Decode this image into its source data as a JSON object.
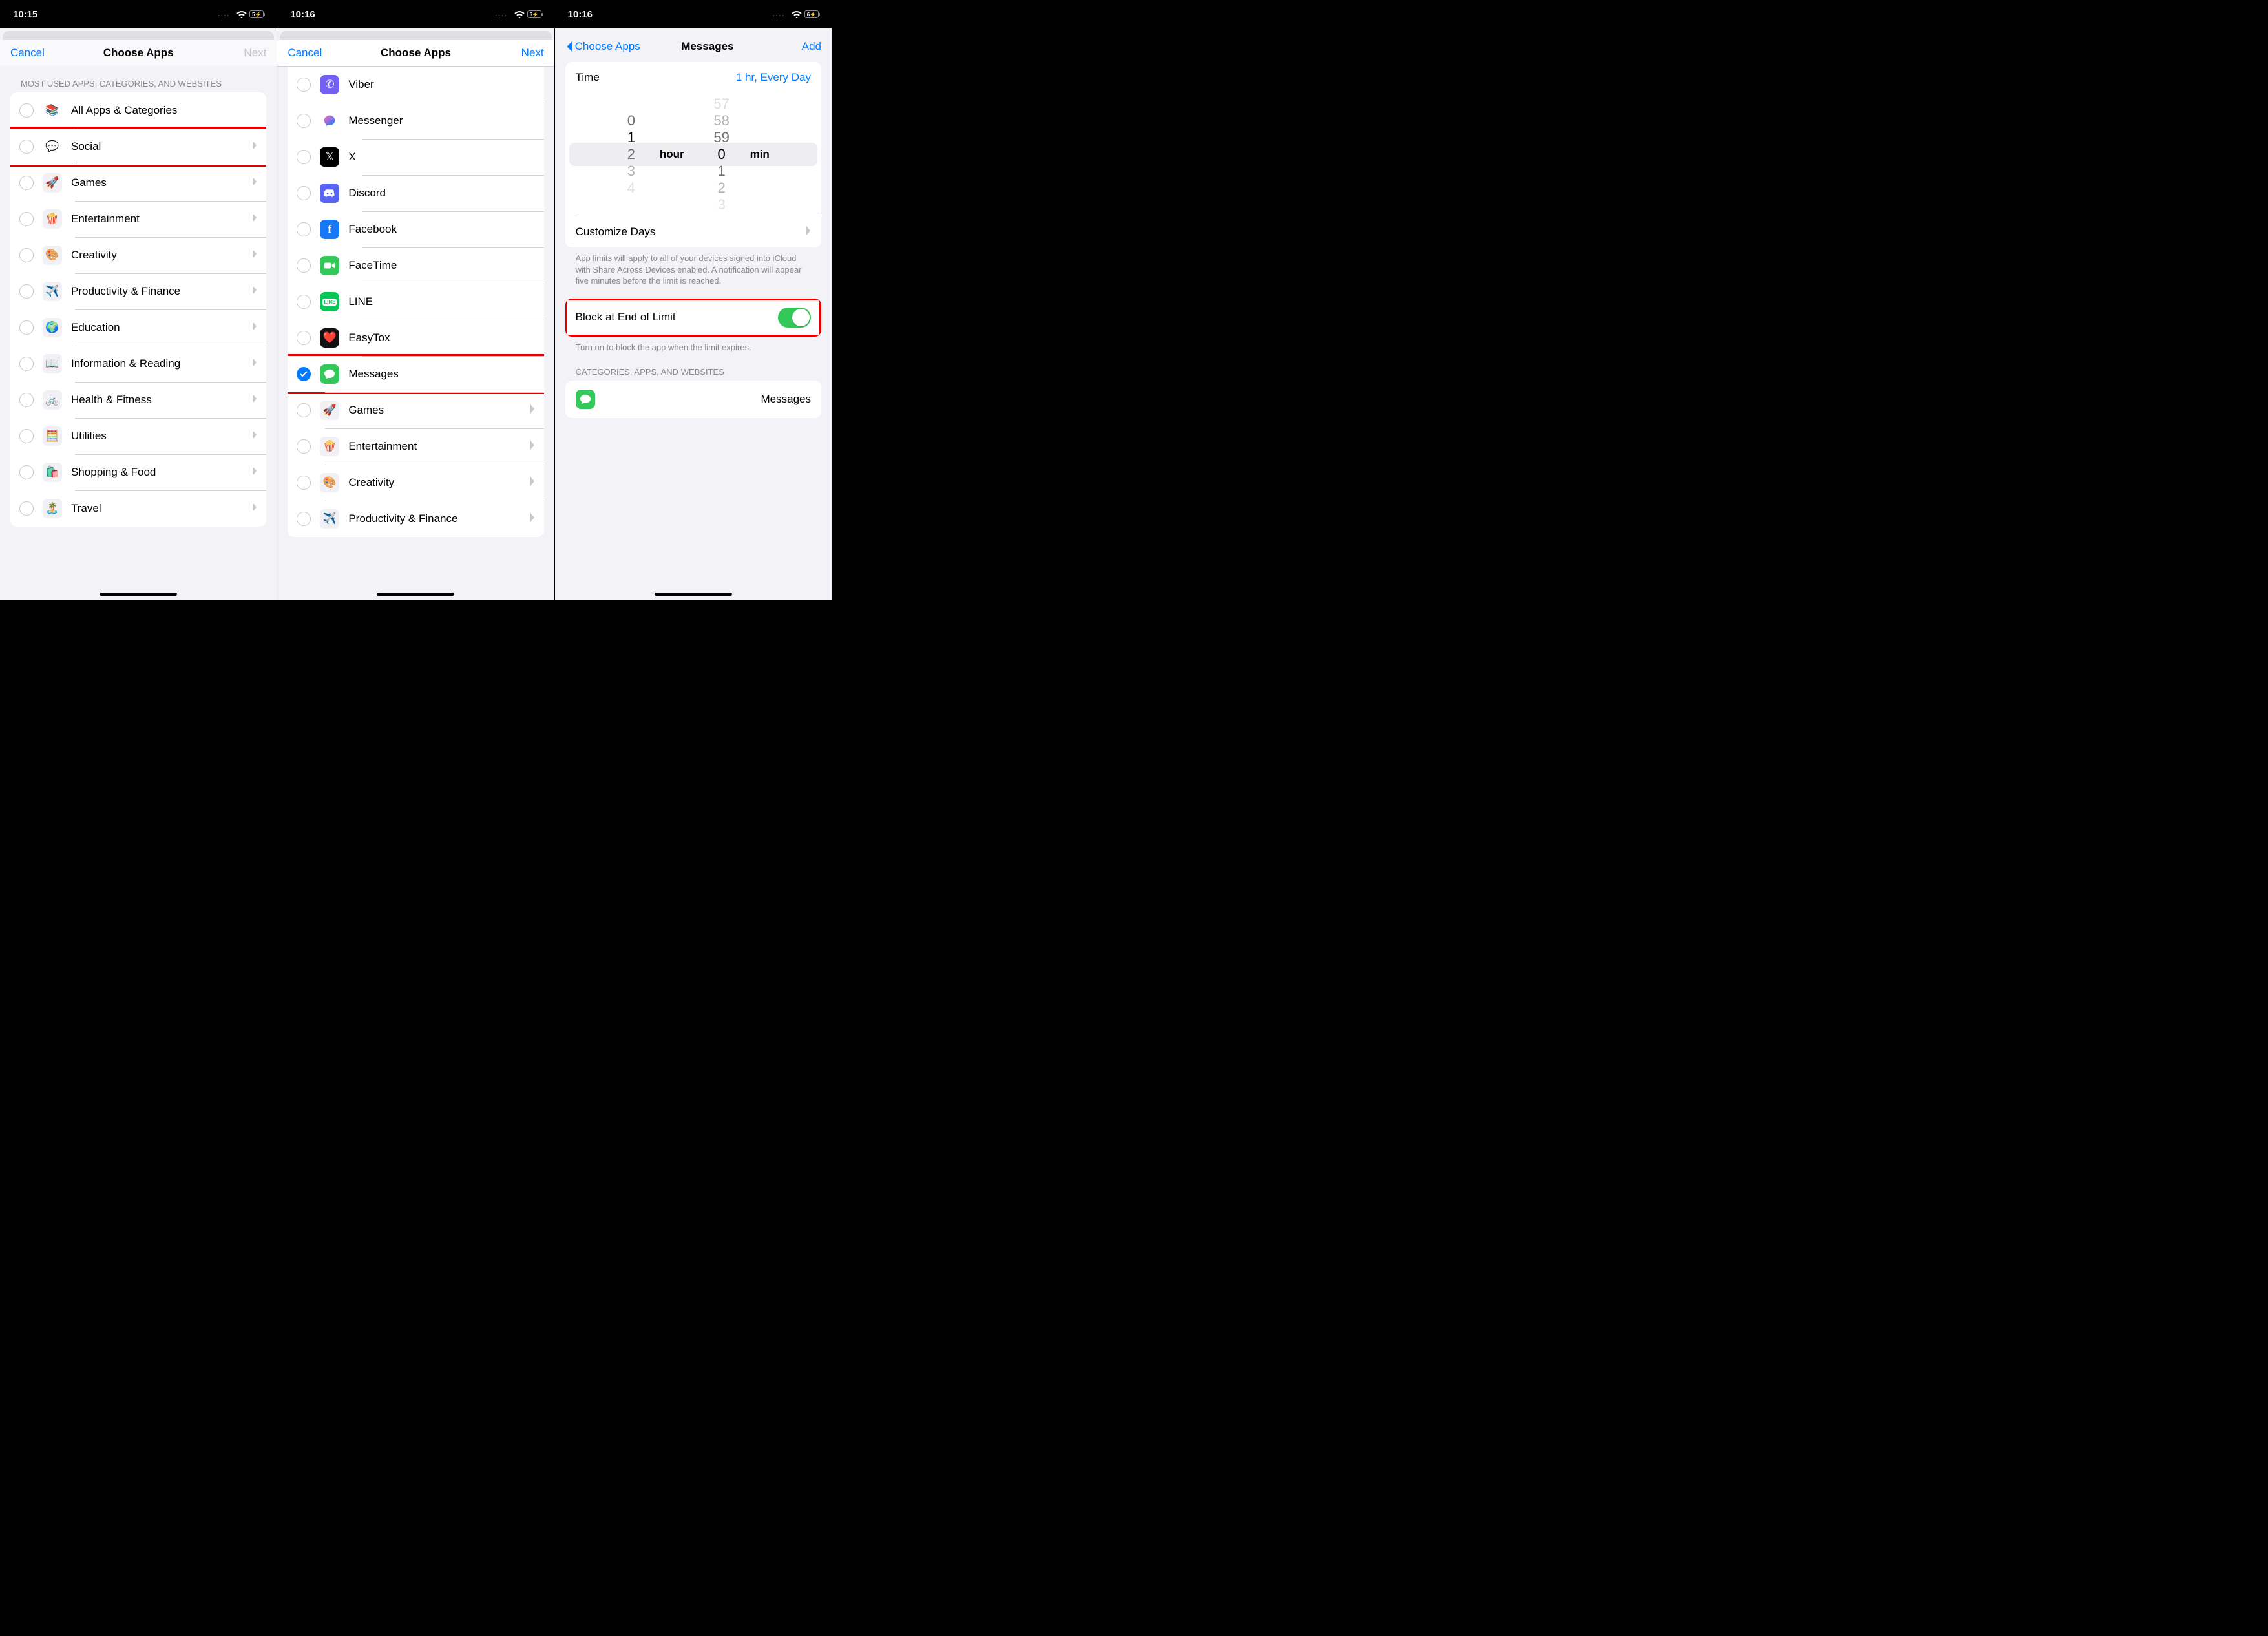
{
  "phone1": {
    "time": "10:15",
    "battery": "5",
    "cancel": "Cancel",
    "title": "Choose Apps",
    "next": "Next",
    "section": "MOST USED APPS, CATEGORIES, AND WEBSITES",
    "rows": [
      {
        "label": "All Apps & Categories"
      },
      {
        "label": "Social"
      },
      {
        "label": "Games"
      },
      {
        "label": "Entertainment"
      },
      {
        "label": "Creativity"
      },
      {
        "label": "Productivity & Finance"
      },
      {
        "label": "Education"
      },
      {
        "label": "Information & Reading"
      },
      {
        "label": "Health & Fitness"
      },
      {
        "label": "Utilities"
      },
      {
        "label": "Shopping & Food"
      },
      {
        "label": "Travel"
      }
    ]
  },
  "phone2": {
    "time": "10:16",
    "battery": "6",
    "cancel": "Cancel",
    "title": "Choose Apps",
    "next": "Next",
    "rows": [
      {
        "label": "Viber"
      },
      {
        "label": "Messenger"
      },
      {
        "label": "X"
      },
      {
        "label": "Discord"
      },
      {
        "label": "Facebook"
      },
      {
        "label": "FaceTime"
      },
      {
        "label": "LINE"
      },
      {
        "label": "EasyTox"
      },
      {
        "label": "Messages"
      },
      {
        "label": "Games"
      },
      {
        "label": "Entertainment"
      },
      {
        "label": "Creativity"
      },
      {
        "label": "Productivity & Finance"
      }
    ]
  },
  "phone3": {
    "time": "10:16",
    "battery": "6",
    "back": "Choose Apps",
    "title": "Messages",
    "add": "Add",
    "time_label": "Time",
    "time_value": "1 hr, Every Day",
    "hour_sel": "1",
    "hour_lbl": "hour",
    "min_sel": "0",
    "min_lbl": "min",
    "picker_hours": [
      "0",
      "1",
      "2",
      "3",
      "4"
    ],
    "picker_mins": [
      "57",
      "58",
      "59",
      "0",
      "1",
      "2",
      "3"
    ],
    "customize": "Customize Days",
    "footer1": "App limits will apply to all of your devices signed into iCloud with Share Across Devices enabled. A notification will appear five minutes before the limit is reached.",
    "block_label": "Block at End of Limit",
    "footer2": "Turn on to block the app when the limit expires.",
    "section2": "CATEGORIES, APPS, AND WEBSITES",
    "app_row": "Messages"
  }
}
